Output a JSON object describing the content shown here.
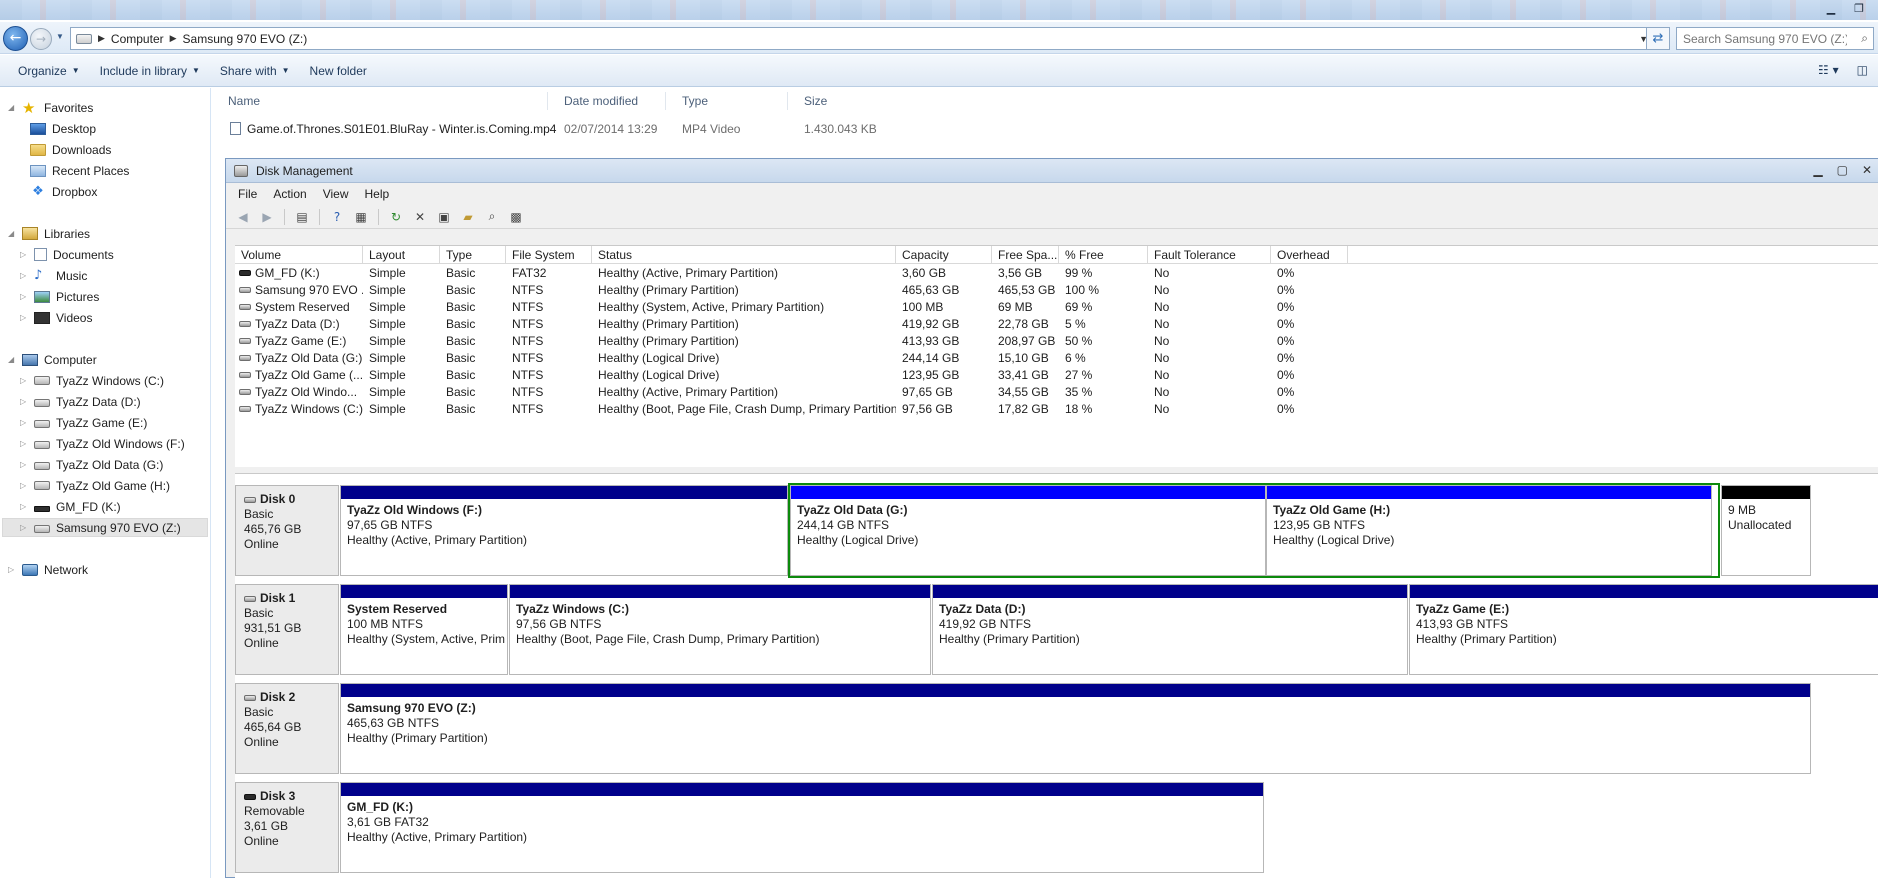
{
  "explorer": {
    "address": {
      "computer": "Computer",
      "drive": "Samsung 970 EVO (Z:)"
    },
    "search_placeholder": "Search Samsung 970 EVO (Z:)",
    "commands": [
      "Organize",
      "Include in library",
      "Share with",
      "New folder"
    ],
    "nav": {
      "favorites": {
        "label": "Favorites",
        "items": [
          "Desktop",
          "Downloads",
          "Recent Places",
          "Dropbox"
        ]
      },
      "libraries": {
        "label": "Libraries",
        "items": [
          "Documents",
          "Music",
          "Pictures",
          "Videos"
        ]
      },
      "computer": {
        "label": "Computer",
        "items": [
          "TyaZz Windows (C:)",
          "TyaZz Data (D:)",
          "TyaZz Game (E:)",
          "TyaZz Old Windows (F:)",
          "TyaZz Old Data (G:)",
          "TyaZz Old Game (H:)",
          "GM_FD (K:)",
          "Samsung 970 EVO (Z:)"
        ]
      },
      "network": {
        "label": "Network"
      }
    },
    "file_columns": [
      "Name",
      "Date modified",
      "Type",
      "Size"
    ],
    "files": [
      {
        "name": "Game.of.Thrones.S01E01.BluRay - Winter.is.Coming.mp4",
        "date": "02/07/2014 13:29",
        "type": "MP4 Video",
        "size": "1.430.043 KB"
      }
    ]
  },
  "disk_management": {
    "title": "Disk Management",
    "menu": [
      "File",
      "Action",
      "View",
      "Help"
    ],
    "columns": [
      "Volume",
      "Layout",
      "Type",
      "File System",
      "Status",
      "Capacity",
      "Free Spa...",
      "% Free",
      "Fault Tolerance",
      "Overhead"
    ],
    "volumes": [
      {
        "volume": "GM_FD (K:)",
        "layout": "Simple",
        "type": "Basic",
        "fs": "FAT32",
        "status": "Healthy (Active, Primary Partition)",
        "capacity": "3,60 GB",
        "free": "3,56 GB",
        "pct": "99 %",
        "ft": "No",
        "overhead": "0%"
      },
      {
        "volume": "Samsung 970 EVO ...",
        "layout": "Simple",
        "type": "Basic",
        "fs": "NTFS",
        "status": "Healthy (Primary Partition)",
        "capacity": "465,63 GB",
        "free": "465,53 GB",
        "pct": "100 %",
        "ft": "No",
        "overhead": "0%"
      },
      {
        "volume": "System Reserved",
        "layout": "Simple",
        "type": "Basic",
        "fs": "NTFS",
        "status": "Healthy (System, Active, Primary Partition)",
        "capacity": "100 MB",
        "free": "69 MB",
        "pct": "69 %",
        "ft": "No",
        "overhead": "0%"
      },
      {
        "volume": "TyaZz Data (D:)",
        "layout": "Simple",
        "type": "Basic",
        "fs": "NTFS",
        "status": "Healthy (Primary Partition)",
        "capacity": "419,92 GB",
        "free": "22,78 GB",
        "pct": "5 %",
        "ft": "No",
        "overhead": "0%"
      },
      {
        "volume": "TyaZz Game (E:)",
        "layout": "Simple",
        "type": "Basic",
        "fs": "NTFS",
        "status": "Healthy (Primary Partition)",
        "capacity": "413,93 GB",
        "free": "208,97 GB",
        "pct": "50 %",
        "ft": "No",
        "overhead": "0%"
      },
      {
        "volume": "TyaZz Old Data (G:)",
        "layout": "Simple",
        "type": "Basic",
        "fs": "NTFS",
        "status": "Healthy (Logical Drive)",
        "capacity": "244,14 GB",
        "free": "15,10 GB",
        "pct": "6 %",
        "ft": "No",
        "overhead": "0%"
      },
      {
        "volume": "TyaZz Old Game (...",
        "layout": "Simple",
        "type": "Basic",
        "fs": "NTFS",
        "status": "Healthy (Logical Drive)",
        "capacity": "123,95 GB",
        "free": "33,41 GB",
        "pct": "27 %",
        "ft": "No",
        "overhead": "0%"
      },
      {
        "volume": "TyaZz Old Windo...",
        "layout": "Simple",
        "type": "Basic",
        "fs": "NTFS",
        "status": "Healthy (Active, Primary Partition)",
        "capacity": "97,65 GB",
        "free": "34,55 GB",
        "pct": "35 %",
        "ft": "No",
        "overhead": "0%"
      },
      {
        "volume": "TyaZz Windows (C:)",
        "layout": "Simple",
        "type": "Basic",
        "fs": "NTFS",
        "status": "Healthy (Boot, Page File, Crash Dump, Primary Partition)",
        "capacity": "97,56 GB",
        "free": "17,82 GB",
        "pct": "18 %",
        "ft": "No",
        "overhead": "0%"
      }
    ],
    "disks": [
      {
        "name": "Disk 0",
        "kind": "Basic",
        "size": "465,76 GB",
        "state": "Online",
        "partitions": [
          {
            "name": "TyaZz Old Windows  (F:)",
            "size": "97,65 GB NTFS",
            "status": "Healthy (Active, Primary Partition)"
          },
          {
            "name": "TyaZz Old Data  (G:)",
            "size": "244,14 GB NTFS",
            "status": "Healthy (Logical Drive)"
          },
          {
            "name": "TyaZz Old Game  (H:)",
            "size": "123,95 GB NTFS",
            "status": "Healthy (Logical Drive)"
          },
          {
            "name": "",
            "size": "9 MB",
            "status": "Unallocated"
          }
        ]
      },
      {
        "name": "Disk 1",
        "kind": "Basic",
        "size": "931,51 GB",
        "state": "Online",
        "partitions": [
          {
            "name": "System Reserved",
            "size": "100 MB NTFS",
            "status": "Healthy (System, Active, Prim"
          },
          {
            "name": "TyaZz Windows  (C:)",
            "size": "97,56 GB NTFS",
            "status": "Healthy (Boot, Page File, Crash Dump, Primary Partition)"
          },
          {
            "name": "TyaZz Data  (D:)",
            "size": "419,92 GB NTFS",
            "status": "Healthy (Primary Partition)"
          },
          {
            "name": "TyaZz Game  (E:)",
            "size": "413,93 GB NTFS",
            "status": "Healthy (Primary Partition)"
          }
        ]
      },
      {
        "name": "Disk 2",
        "kind": "Basic",
        "size": "465,64 GB",
        "state": "Online",
        "partitions": [
          {
            "name": "Samsung 970 EVO  (Z:)",
            "size": "465,63 GB NTFS",
            "status": "Healthy (Primary Partition)"
          }
        ]
      },
      {
        "name": "Disk 3",
        "kind": "Removable",
        "size": "3,61 GB",
        "state": "Online",
        "partitions": [
          {
            "name": "GM_FD  (K:)",
            "size": "3,61 GB FAT32",
            "status": "Healthy (Active, Primary Partition)"
          }
        ]
      }
    ]
  }
}
